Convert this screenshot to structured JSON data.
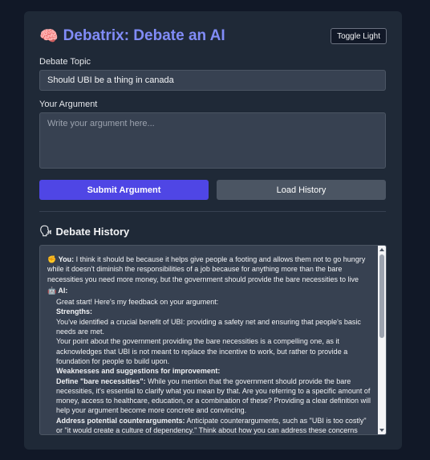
{
  "header": {
    "icon": "brain-icon",
    "icon_glyph": "🧠",
    "title": "Debatrix: Debate an AI",
    "toggle_label": "Toggle Light"
  },
  "form": {
    "topic_label": "Debate Topic",
    "topic_value": "Should UBI be a thing in canada",
    "argument_label": "Your Argument",
    "argument_placeholder": "Write your argument here...",
    "submit_label": "Submit Argument",
    "history_button_label": "Load History"
  },
  "history": {
    "icon": "speech-icon",
    "icon_glyph": "🗣",
    "title": "Debate History",
    "user_icon_glyph": "✊",
    "user_label": "You:",
    "user_text": "I think it should be because it helps give people a footing and allows them not to go hungry while it doesn't diminish the responsibilities of a job because for anything more than the bare necessities you need more money, but the government should provide the bare necessities to live",
    "ai_icon_glyph": "🤖",
    "ai_label": "AI:",
    "ai_intro": "Great start! Here's my feedback on your argument:",
    "strengths_heading": "Strengths:",
    "strength_1": "You've identified a crucial benefit of UBI: providing a safety net and ensuring that people's basic needs are met.",
    "strength_2": "Your point about the government providing the bare necessities is a compelling one, as it acknowledges that UBI is not meant to replace the incentive to work, but rather to provide a foundation for people to build upon.",
    "weaknesses_heading": "Weaknesses and suggestions for improvement:",
    "define_heading": "Define \"bare necessities\":",
    "define_text": "While you mention that the government should provide the bare necessities, it's essential to clarify what you mean by that. Are you referring to a specific amount of money, access to healthcare, education, or a combination of these? Providing a clear definition will help your argument become more concrete and convincing.",
    "counter_heading": "Address potential counterarguments:",
    "counter_text": "Anticipate counterarguments, such as \"UBI is too costly\" or \"it would create a culture of dependency.\" Think about how you can address these concerns and provide"
  },
  "colors": {
    "background": "#111827",
    "card": "#1f2937",
    "accent_title": "#818cf8",
    "submit_button": "#4f46e5",
    "secondary_button": "#4b5563",
    "input_bg": "#374151"
  }
}
